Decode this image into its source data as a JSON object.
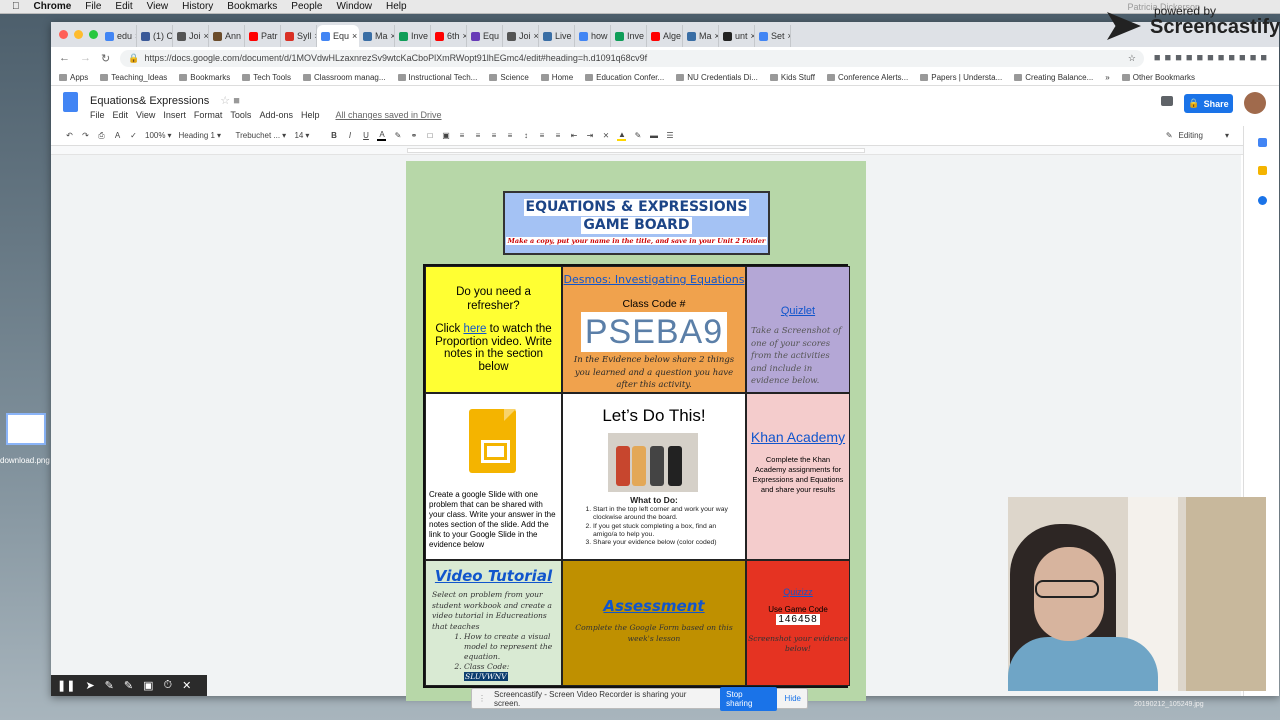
{
  "mac_menu": {
    "app": "Chrome",
    "items": [
      "File",
      "Edit",
      "View",
      "History",
      "Bookmarks",
      "People",
      "Window",
      "Help"
    ]
  },
  "tabs": [
    {
      "label": "edu",
      "color": "#4285f4"
    },
    {
      "label": "(1) C",
      "color": "#3b5998"
    },
    {
      "label": "Joi",
      "color": "#555"
    },
    {
      "label": "Ann",
      "color": "#6b4c2b"
    },
    {
      "label": "Patr",
      "color": "#ff0000"
    },
    {
      "label": "Syll",
      "color": "#d93025"
    },
    {
      "label": "Equ",
      "color": "#4285f4"
    },
    {
      "label": "Ma",
      "color": "#3a6ea5"
    },
    {
      "label": "Inve",
      "color": "#0f9d58"
    },
    {
      "label": "6th",
      "color": "#ff0000"
    },
    {
      "label": "Equ",
      "color": "#673ab7"
    },
    {
      "label": "Joi",
      "color": "#555"
    },
    {
      "label": "Live",
      "color": "#3a6ea5"
    },
    {
      "label": "how",
      "color": "#4285f4"
    },
    {
      "label": "Inve",
      "color": "#0f9d58"
    },
    {
      "label": "Alge",
      "color": "#ff0000"
    },
    {
      "label": "Ma",
      "color": "#3a6ea5"
    },
    {
      "label": "unt",
      "color": "#222"
    },
    {
      "label": "Set",
      "color": "#4285f4"
    }
  ],
  "url": "https://docs.google.com/document/d/1MOVdwHLzaxnrezSv9wtcKaCboPlXmRWopt91lhEGmc4/edit#heading=h.d1091q68cv9f",
  "bookmarks": [
    "Apps",
    "Teaching_Ideas",
    "Bookmarks",
    "Tech Tools",
    "Classroom manag...",
    "Instructional Tech...",
    "Science",
    "Home",
    "Education Confer...",
    "NU Credentials Di...",
    "Kids Stuff",
    "Conference Alerts...",
    "Papers | Understa...",
    "Creating Balance...",
    "»",
    "Other Bookmarks"
  ],
  "doc": {
    "title": "Equations& Expressions",
    "menus": [
      "File",
      "Edit",
      "View",
      "Insert",
      "Format",
      "Tools",
      "Add-ons",
      "Help"
    ],
    "saved": "All changes saved in Drive",
    "share": "Share",
    "mode": "Editing",
    "style": "Heading 1",
    "font": "Trebuchet ...",
    "size": "14",
    "zoom": "100%"
  },
  "board": {
    "title1": "EQUATIONS & EXPRESSIONS",
    "title2": "GAME BOARD",
    "subtitle": "Make a copy, put your name in the title, and save in your Unit 2 Folder",
    "c1": {
      "q": "Do you need a refresher?",
      "pre": "Click ",
      "link": "here",
      "post": " to watch the Proportion video. Write notes in the section below"
    },
    "c2": {
      "h": "Desmos: Investigating Equations",
      "cc": "Class Code #",
      "code": "PSEBA9",
      "ev": "In the Evidence below share 2 things you learned and a question you have after this  activity."
    },
    "c3": {
      "h": "Quizlet",
      "p": "Take a Screenshot of one of your scores from the activities and include in evidence below."
    },
    "c4": {
      "p": "Create a google Slide with one problem that can be shared with your class.  Write your answer in the notes section of the slide. Add the link to your Google Slide in the evidence below"
    },
    "c5": {
      "h": "Let’s Do This!",
      "wt": "What to Do:",
      "steps": [
        "Start in the top left corner and work your way clockwise around the board.",
        "If you get stuck completing a box, find an amigo/a to help you.",
        "Share your evidence below (color coded)"
      ]
    },
    "c6": {
      "h": "Khan Academy",
      "p": "Complete the Khan Academy assignments for Expressions and Equations and share your results"
    },
    "c7": {
      "h": "Video Tutorial",
      "p": "Select on problem from your student workbook and create a video tutorial in Educreations that teaches",
      "s1": "How to create a visual model to represent the equation.",
      "s2": "Class Code: ",
      "code": "SLUVWNV"
    },
    "c8": {
      "h": "Assessment",
      "p": "Complete the Google Form based on this week's lesson"
    },
    "c9": {
      "h": "Quizizz",
      "u": "Use Game Code",
      "code": "146458",
      "p": "Screenshot your evidence below!"
    }
  },
  "screencastify": {
    "powered": "powered by",
    "name": "Screencastify",
    "share_msg": "Screencastify - Screen Video Recorder is sharing your screen.",
    "stop": "Stop sharing",
    "hide": "Hide",
    "faded_user": "Patricia Dickerson"
  },
  "desktop": {
    "download": "download.png",
    "file": "20190212_105249.jpg"
  }
}
